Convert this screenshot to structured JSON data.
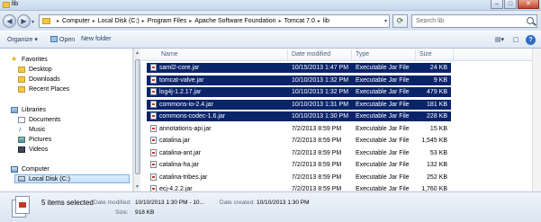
{
  "window": {
    "title": "lib",
    "controls": {
      "minimize": "–",
      "maximize": "□",
      "close": "✕"
    }
  },
  "address": {
    "crumbs": [
      "Computer",
      "Local Disk (C:)",
      "Program Files",
      "Apache Software Foundation",
      "Tomcat 7.0",
      "lib"
    ],
    "search_placeholder": "Search lib"
  },
  "toolbar": {
    "organize": "Organize ▾",
    "open": "Open",
    "new_folder": "New folder"
  },
  "nav": {
    "favorites_header": "Favorites",
    "favorites": [
      "Desktop",
      "Downloads",
      "Recent Places"
    ],
    "libraries_header": "Libraries",
    "libraries": [
      "Documents",
      "Music",
      "Pictures",
      "Videos"
    ],
    "computer_header": "Computer",
    "computer_items": [
      "Local Disk (C:)"
    ]
  },
  "columns": {
    "name": "Name",
    "date": "Date modified",
    "type": "Type",
    "size": "Size"
  },
  "files": [
    {
      "name": "saml2-core.jar",
      "date": "10/15/2013 1:47 PM",
      "type": "Executable Jar File",
      "size": "24 KB",
      "selected": true
    },
    {
      "name": "tomcat-valve.jar",
      "date": "10/10/2013 1:32 PM",
      "type": "Executable Jar File",
      "size": "9 KB",
      "selected": true
    },
    {
      "name": "log4j-1.2.17.jar",
      "date": "10/10/2013 1:32 PM",
      "type": "Executable Jar File",
      "size": "479 KB",
      "selected": true
    },
    {
      "name": "commons-io-2.4.jar",
      "date": "10/10/2013 1:31 PM",
      "type": "Executable Jar File",
      "size": "181 KB",
      "selected": true
    },
    {
      "name": "commons-codec-1.6.jar",
      "date": "10/10/2013 1:30 PM",
      "type": "Executable Jar File",
      "size": "228 KB",
      "selected": true
    },
    {
      "name": "annotations-api.jar",
      "date": "7/2/2013 8:59 PM",
      "type": "Executable Jar File",
      "size": "15 KB",
      "selected": false
    },
    {
      "name": "catalina.jar",
      "date": "7/2/2013 8:59 PM",
      "type": "Executable Jar File",
      "size": "1,545 KB",
      "selected": false
    },
    {
      "name": "catalina-ant.jar",
      "date": "7/2/2013 8:59 PM",
      "type": "Executable Jar File",
      "size": "53 KB",
      "selected": false
    },
    {
      "name": "catalina-ha.jar",
      "date": "7/2/2013 8:59 PM",
      "type": "Executable Jar File",
      "size": "132 KB",
      "selected": false
    },
    {
      "name": "catalina-tribes.jar",
      "date": "7/2/2013 8:59 PM",
      "type": "Executable Jar File",
      "size": "252 KB",
      "selected": false
    },
    {
      "name": "ecj-4.2.2.jar",
      "date": "7/2/2013 8:59 PM",
      "type": "Executable Jar File",
      "size": "1,760 KB",
      "selected": false
    }
  ],
  "details": {
    "title": "5 items selected",
    "date_modified_label": "Date modified:",
    "date_modified_value": "10/10/2013 1:30 PM - 10...",
    "date_created_label": "Date created:",
    "date_created_value": "10/10/2013 1:30 PM",
    "size_label": "Size:",
    "size_value": "918 KB"
  }
}
